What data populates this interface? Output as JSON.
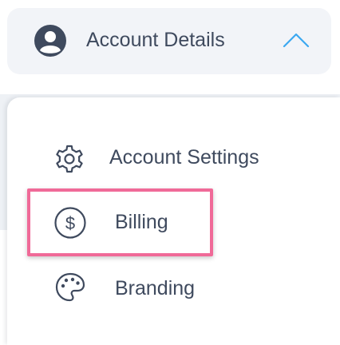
{
  "header": {
    "label": "Account Details",
    "avatar_icon": "user-circle-icon",
    "toggle_icon": "chevron-up-icon",
    "accent_color": "#3ba8f0"
  },
  "menu": {
    "items": [
      {
        "label": "Account Settings",
        "icon": "gear-icon"
      },
      {
        "label": "Billing",
        "icon": "dollar-circle-icon",
        "highlighted": true
      },
      {
        "label": "Branding",
        "icon": "palette-icon"
      }
    ]
  },
  "colors": {
    "text": "#3f4a5e",
    "header_background": "#f2f4f8",
    "highlight_border": "#f06a98"
  }
}
